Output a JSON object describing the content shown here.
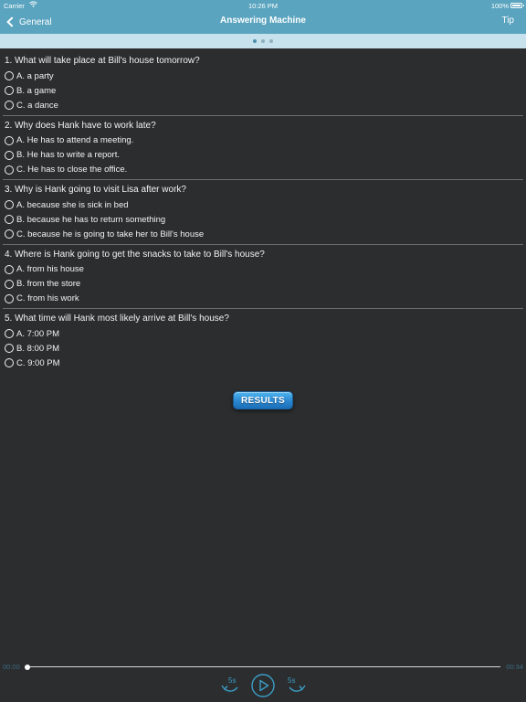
{
  "status_bar": {
    "carrier": "Carrier",
    "time": "10:26 PM",
    "battery": "100%"
  },
  "nav": {
    "back_label": "General",
    "title": "Answering Machine",
    "tip_label": "Tip"
  },
  "pager": {
    "pages": 3,
    "active_index": 0
  },
  "questions": [
    {
      "text": "1. What will take place at Bill's house tomorrow?",
      "options": [
        "A. a party",
        "B. a game",
        "C. a dance"
      ]
    },
    {
      "text": "2. Why does Hank have to work late?",
      "options": [
        "A. He has to attend a meeting.",
        "B. He has to write a report.",
        "C. He has to close the office."
      ]
    },
    {
      "text": "3. Why is Hank going to visit Lisa after work?",
      "options": [
        "A. because she is sick in bed",
        "B. because he has to return something",
        "C. because he is going to take her to Bill's house"
      ]
    },
    {
      "text": "4. Where is Hank going to get the snacks to take to Bill's house?",
      "options": [
        "A. from his house",
        "B. from the store",
        "C. from his work"
      ]
    },
    {
      "text": "5. What time will Hank most likely arrive at Bill's house?",
      "options": [
        "A. 7:00 PM",
        "B. 8:00 PM",
        "C. 9:00 PM"
      ]
    }
  ],
  "results_label": "RESULTS",
  "player": {
    "elapsed": "00:00",
    "total": "00:34",
    "progress": 0,
    "rewind_label": "5s",
    "forward_label": "5s"
  },
  "colors": {
    "nav_bar": "#5aa4bf",
    "pager_strip": "#c7e2ec",
    "background": "#2b2d2f",
    "accent": "#3a9cc4"
  }
}
